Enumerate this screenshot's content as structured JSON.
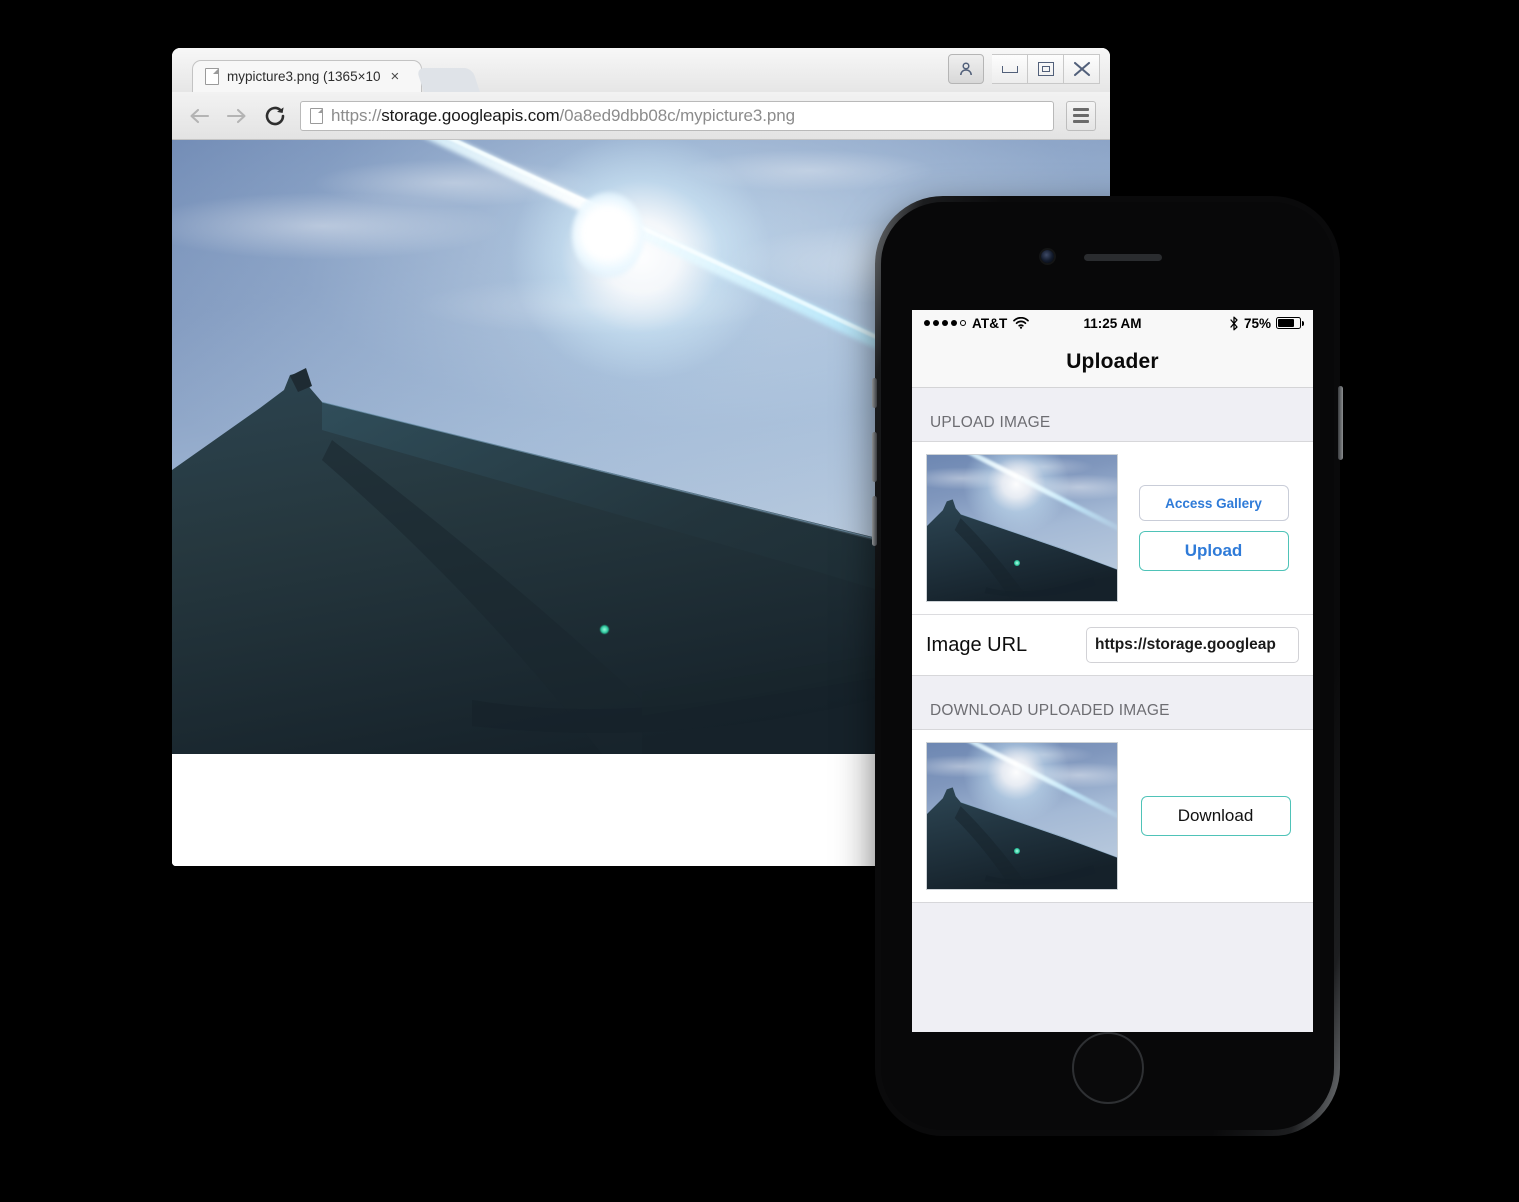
{
  "browser": {
    "tab": {
      "title": "mypicture3.png (1365×10",
      "close_label": "×",
      "favicon": "document-icon"
    },
    "window_controls": {
      "user_icon": "user-account-icon",
      "minimize_label": "minimize-icon",
      "maximize_label": "maximize-icon",
      "close_label": "close-icon"
    },
    "toolbar": {
      "back_icon": "back-arrow-icon",
      "forward_icon": "forward-arrow-icon",
      "reload_icon": "reload-icon",
      "menu_icon": "hamburger-menu-icon"
    },
    "address_bar": {
      "scheme": "https://",
      "host": "storage.googleapis.com",
      "path": "/0a8ed9dbb08c/mypicture3.png",
      "full_url": "https://storage.googleapis.com/0a8ed9dbb08c/mypicture3.png"
    },
    "page_content": {
      "image_description": "Photo of a dark umbrella canopy silhouetted against a blue sky with bright sun and lens flare"
    }
  },
  "phone": {
    "status_bar": {
      "signal_dots_filled": 4,
      "signal_dots_total": 5,
      "carrier": "AT&T",
      "wifi_icon": "wifi-icon",
      "time": "11:25 AM",
      "bluetooth_icon": "bluetooth-icon",
      "battery_percent": "75%",
      "battery_level": 75
    },
    "nav_bar": {
      "title": "Uploader"
    },
    "sections": {
      "upload": {
        "header": "UPLOAD IMAGE",
        "thumbnail_alt": "uploaded-image-preview",
        "buttons": {
          "gallery": "Access Gallery",
          "upload": "Upload"
        }
      },
      "image_url": {
        "label": "Image URL",
        "value": "https://storage.googleap",
        "placeholder": "Image URL"
      },
      "download": {
        "header": "DOWNLOAD UPLOADED IMAGE",
        "thumbnail_alt": "downloaded-image-preview",
        "button": "Download"
      }
    },
    "hardware": {
      "camera": "front-camera",
      "earpiece": "earpiece-speaker",
      "home_button": "home-button"
    }
  },
  "colors": {
    "accent_blue": "#2f7bd8",
    "accent_teal": "#4fc3b8",
    "ios_group_bg": "#efeff4",
    "ios_header_text": "#6d6d72"
  }
}
